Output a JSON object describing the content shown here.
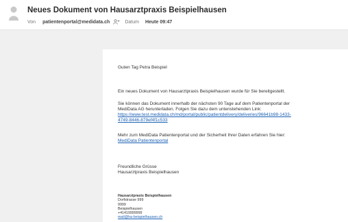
{
  "header": {
    "subject": "Neues Dokument von Hausarztpraxis Beispielhausen",
    "from_label": "Von",
    "sender": "patientenportal@medidata.ch",
    "date_label": "Datum",
    "date_value": "Heute 09:47"
  },
  "email": {
    "greeting": "Guten Tag Petra Beispiel",
    "p1": "Ein neues Dokument von Hausarztpraxis Beispielhausen wurde für Sie bereitgestellt.",
    "p2_line1": "Sie können das Dokument innerhalb der nächsten 90 Tage auf dem Patientenportal der",
    "p2_line2": "MediData AG herunterladen. Folgen Sie dazu dem untenstehenden Link:",
    "link1_line1": "https://www.test.medidata.ch/md/portal/public/patientdelivery/deliveries/96641b98-1433-",
    "link1_line2": "4749-8446-879ef4f1c533",
    "p3": "Mehr zum MediData Patientenportal und der Sicherheit Ihrer Daten erfahren Sie hier:",
    "link2": "MediData Patientenportal",
    "closing1": "Freundliche Grüsse",
    "closing2": "Hausarztpraxis Beispielhausen"
  },
  "signature": {
    "name": "Hausarztpraxis Beispielhausen",
    "street": "Dorfstrasse 999",
    "zip": "9999",
    "city": "Beispielhausen",
    "phone": "+41419999999",
    "email": "mail@ha-beispielhausen.ch"
  },
  "icons": {
    "avatar": "user-avatar-icon",
    "add_contact": "add-contact-icon"
  }
}
